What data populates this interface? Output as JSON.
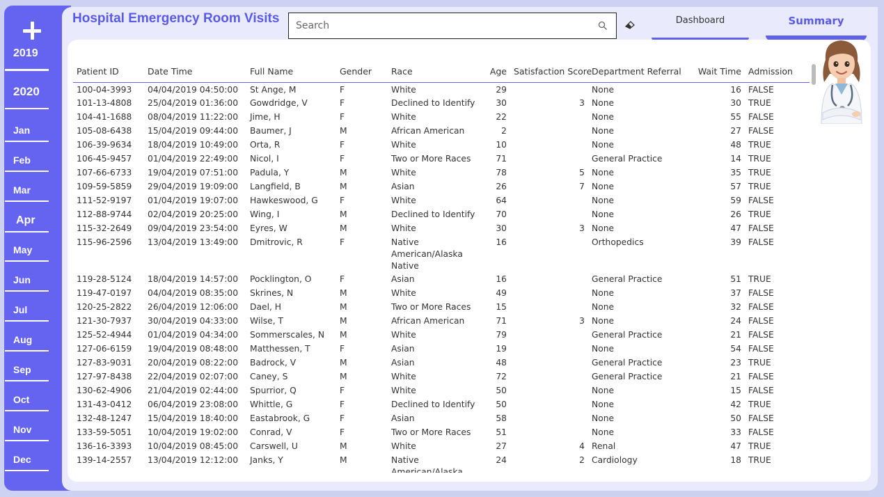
{
  "app": {
    "title": "Hospital Emergency Room Visits",
    "accent": "#6464f0"
  },
  "sidebar": {
    "add_icon": "plus-icon",
    "items": [
      {
        "label": "2019",
        "kind": "year",
        "selected": true
      },
      {
        "label": "2020",
        "kind": "year",
        "selected": false
      },
      {
        "label": "Jan",
        "kind": "month",
        "selected": false
      },
      {
        "label": "Feb",
        "kind": "month",
        "selected": false
      },
      {
        "label": "Mar",
        "kind": "month",
        "selected": false
      },
      {
        "label": "Apr",
        "kind": "month",
        "selected": true
      },
      {
        "label": "May",
        "kind": "month",
        "selected": false
      },
      {
        "label": "Jun",
        "kind": "month",
        "selected": false
      },
      {
        "label": "Jul",
        "kind": "month",
        "selected": false
      },
      {
        "label": "Aug",
        "kind": "month",
        "selected": false
      },
      {
        "label": "Sep",
        "kind": "month",
        "selected": false
      },
      {
        "label": "Oct",
        "kind": "month",
        "selected": false
      },
      {
        "label": "Nov",
        "kind": "month",
        "selected": false
      },
      {
        "label": "Dec",
        "kind": "month",
        "selected": false
      }
    ]
  },
  "search": {
    "placeholder": "Search",
    "value": "",
    "icon": "search-icon",
    "clear_icon": "eraser-icon"
  },
  "tabs": [
    {
      "label": "Dashboard",
      "active": false
    },
    {
      "label": "Summary",
      "active": true
    }
  ],
  "table": {
    "columns": [
      "Patient ID",
      "Date Time",
      "Full Name",
      "Gender",
      "Race",
      "Age",
      "Satisfaction Score",
      "Department Referral",
      "Wait Time",
      "Admission"
    ],
    "rows": [
      [
        "100-04-3993",
        "04/04/2019 04:50:00",
        "St Ange, M",
        "F",
        "White",
        "29",
        "",
        "None",
        "16",
        "FALSE"
      ],
      [
        "101-13-4808",
        "25/04/2019 01:36:00",
        "Gowdridge, V",
        "F",
        "Declined to Identify",
        "30",
        "3",
        "None",
        "30",
        "TRUE"
      ],
      [
        "104-41-1688",
        "08/04/2019 11:22:00",
        "Jime, H",
        "F",
        "White",
        "22",
        "",
        "None",
        "55",
        "FALSE"
      ],
      [
        "105-08-6438",
        "15/04/2019 09:44:00",
        "Baumer, J",
        "M",
        "African American",
        "2",
        "",
        "None",
        "27",
        "FALSE"
      ],
      [
        "106-39-9634",
        "18/04/2019 10:49:00",
        "Orta, R",
        "F",
        "White",
        "10",
        "",
        "None",
        "48",
        "TRUE"
      ],
      [
        "106-45-9457",
        "01/04/2019 22:49:00",
        "Nicol, I",
        "F",
        "Two or More Races",
        "71",
        "",
        "General Practice",
        "14",
        "TRUE"
      ],
      [
        "107-66-6733",
        "19/04/2019 07:51:00",
        "Padula, Y",
        "M",
        "White",
        "78",
        "5",
        "None",
        "35",
        "TRUE"
      ],
      [
        "109-59-5859",
        "29/04/2019 19:09:00",
        "Langfield, B",
        "M",
        "Asian",
        "26",
        "7",
        "None",
        "57",
        "TRUE"
      ],
      [
        "111-52-9197",
        "01/04/2019 19:07:00",
        "Hawkeswood, G",
        "F",
        "White",
        "64",
        "",
        "None",
        "59",
        "FALSE"
      ],
      [
        "112-88-9744",
        "02/04/2019 20:25:00",
        "Wing, I",
        "M",
        "Declined to Identify",
        "70",
        "",
        "None",
        "26",
        "TRUE"
      ],
      [
        "115-32-2649",
        "09/04/2019 23:54:00",
        "Eyres, W",
        "M",
        "White",
        "30",
        "3",
        "None",
        "47",
        "FALSE"
      ],
      [
        "115-96-2596",
        "13/04/2019 13:49:00",
        "Dmitrovic, R",
        "F",
        "Native American/Alaska Native",
        "16",
        "",
        "Orthopedics",
        "39",
        "FALSE"
      ],
      [
        "119-28-5124",
        "18/04/2019 14:57:00",
        "Pocklington, O",
        "F",
        "Asian",
        "16",
        "",
        "General Practice",
        "51",
        "TRUE"
      ],
      [
        "119-47-0197",
        "04/04/2019 08:35:00",
        "Skrines, N",
        "M",
        "White",
        "49",
        "",
        "None",
        "37",
        "FALSE"
      ],
      [
        "120-25-2822",
        "26/04/2019 12:06:00",
        "Dael, H",
        "M",
        "Two or More Races",
        "15",
        "",
        "None",
        "32",
        "FALSE"
      ],
      [
        "121-30-7937",
        "30/04/2019 04:33:00",
        "Wilse, T",
        "M",
        "African American",
        "71",
        "3",
        "None",
        "24",
        "FALSE"
      ],
      [
        "125-52-4944",
        "01/04/2019 04:34:00",
        "Sommerscales, N",
        "M",
        "White",
        "79",
        "",
        "General Practice",
        "21",
        "FALSE"
      ],
      [
        "127-06-6159",
        "19/04/2019 08:48:00",
        "Matthessen, T",
        "F",
        "Asian",
        "19",
        "",
        "None",
        "54",
        "FALSE"
      ],
      [
        "127-83-9031",
        "20/04/2019 08:22:00",
        "Badrock, V",
        "M",
        "Asian",
        "48",
        "",
        "General Practice",
        "23",
        "TRUE"
      ],
      [
        "127-97-8438",
        "22/04/2019 02:07:00",
        "Caney, S",
        "M",
        "White",
        "72",
        "",
        "General Practice",
        "21",
        "FALSE"
      ],
      [
        "130-62-4906",
        "21/04/2019 02:44:00",
        "Spurrior, Q",
        "F",
        "White",
        "50",
        "",
        "None",
        "15",
        "FALSE"
      ],
      [
        "131-43-0412",
        "06/04/2019 23:08:00",
        "Whittle, G",
        "F",
        "Declined to Identify",
        "50",
        "",
        "None",
        "42",
        "TRUE"
      ],
      [
        "132-48-1247",
        "15/04/2019 18:40:00",
        "Eastabrook, G",
        "F",
        "Asian",
        "58",
        "",
        "None",
        "50",
        "FALSE"
      ],
      [
        "133-59-5051",
        "10/04/2019 19:02:00",
        "Conrad, V",
        "F",
        "Two or More Races",
        "51",
        "",
        "None",
        "33",
        "FALSE"
      ],
      [
        "136-16-3393",
        "10/04/2019 08:45:00",
        "Carswell, U",
        "M",
        "White",
        "27",
        "4",
        "Renal",
        "47",
        "TRUE"
      ],
      [
        "139-14-2557",
        "13/04/2019 12:12:00",
        "Janks, Y",
        "M",
        "Native American/Alaska Native",
        "24",
        "2",
        "Cardiology",
        "18",
        "TRUE"
      ]
    ]
  },
  "avatar": {
    "icon": "nurse-avatar-icon"
  }
}
